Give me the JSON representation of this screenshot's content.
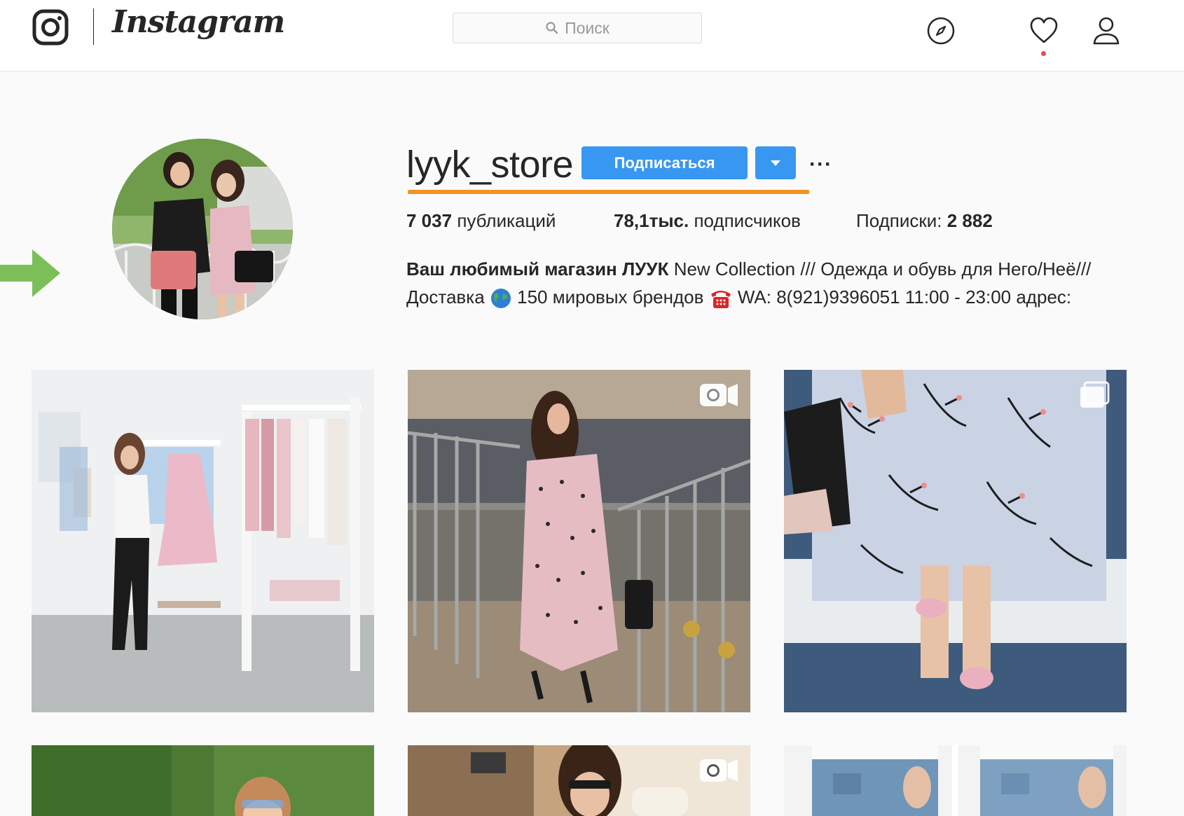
{
  "nav": {
    "brand": "Instagram",
    "search_placeholder": "Поиск"
  },
  "profile": {
    "username": "lyyk_store",
    "follow_label": "Подписаться",
    "more_label": "···",
    "stats": {
      "posts_value": "7 037",
      "posts_label": "публикаций",
      "followers_value": "78,1тыс.",
      "followers_label": "подписчиков",
      "following_label": "Подписки:",
      "following_value": "2 882"
    },
    "bio": {
      "name": "Ваш любимый магазин ЛУУК",
      "line1_rest": "New Collection /// Одежда и обувь для Него/Неё///",
      "line2_a": "Доставка",
      "line2_b": "150 мировых брендов",
      "line2_c": "WA: 8(921)9396051 11:00 - 23:00 адрес:"
    }
  },
  "posts": [
    {
      "id": "post-1",
      "type": "photo"
    },
    {
      "id": "post-2",
      "type": "video"
    },
    {
      "id": "post-3",
      "type": "gallery"
    },
    {
      "id": "post-4",
      "type": "photo"
    },
    {
      "id": "post-5",
      "type": "video"
    },
    {
      "id": "post-6",
      "type": "photo"
    }
  ],
  "colors": {
    "accent_blue": "#3897f0",
    "highlight_orange": "#f39322",
    "arrow_green": "#7cbf58",
    "notification_red": "#ed4956"
  },
  "icons": [
    "instagram-glyph-icon",
    "search-icon",
    "compass-icon",
    "heart-icon",
    "user-icon",
    "chevron-down-icon",
    "globe-icon",
    "telephone-icon",
    "video-icon",
    "gallery-icon"
  ]
}
